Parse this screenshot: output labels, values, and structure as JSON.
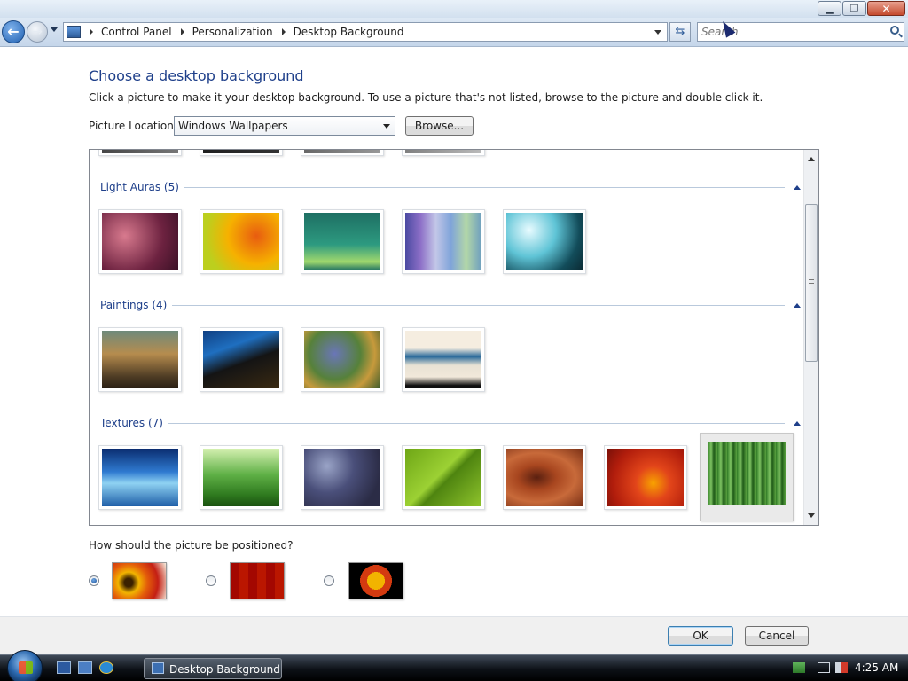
{
  "window": {
    "controls": {
      "minimize": "▁",
      "maximize": "❐",
      "close": "✕"
    }
  },
  "address_bar": {
    "back_icon": "←",
    "forward_icon": "→",
    "breadcrumbs": [
      "Control Panel",
      "Personalization",
      "Desktop Background"
    ],
    "refresh_icon": "⇆",
    "search_placeholder": "Search"
  },
  "main": {
    "title": "Choose a desktop background",
    "description": "Click a picture to make it your desktop background. To use a picture that's not listed, browse to the picture and double click it.",
    "picture_location_label": "Picture Location",
    "picture_location_value": "Windows Wallpapers",
    "browse_label": "Browse...",
    "groups": [
      {
        "title": "Light Auras (5)"
      },
      {
        "title": "Paintings (4)"
      },
      {
        "title": "Textures (7)"
      }
    ],
    "position_question": "How should the picture be positioned?",
    "position_options": [
      "fill-screen",
      "tile",
      "center"
    ],
    "selected_position": "fill-screen",
    "selected_thumbnail": "Textures 7 (bamboo)"
  },
  "footer": {
    "ok_label": "OK",
    "cancel_label": "Cancel"
  },
  "taskbar": {
    "task_label": "Desktop Background",
    "clock": "4:25 AM"
  },
  "colors": {
    "accent_blue": "#1e3f8a",
    "group_line": "#b9c9dc"
  }
}
